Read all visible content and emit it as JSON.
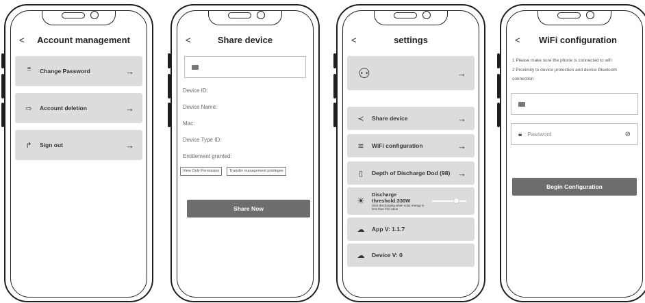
{
  "account": {
    "title": "Account management",
    "back": "<",
    "items": [
      {
        "label": "Change Password",
        "icon": "password-dots-icon"
      },
      {
        "label": "Account deletion",
        "icon": "logout-arrow-icon"
      },
      {
        "label": "Sign out",
        "icon": "sign-out-icon"
      }
    ],
    "arrow": "→"
  },
  "share": {
    "title": "Share device",
    "back": "<",
    "email_placeholder": "",
    "fields": [
      "Device ID:",
      "Device Name:",
      "Mac:",
      "Device Type ID:",
      "Entitlement granted:"
    ],
    "perm_view": "View Only Permission",
    "perm_transfer": "Transfer management privileges",
    "submit": "Share Now"
  },
  "settings": {
    "title": "settings",
    "back": "<",
    "arrow": "→",
    "items": [
      {
        "label": "Share device",
        "icon": "share-icon"
      },
      {
        "label": "WiFi configuration",
        "icon": "wifi-icon"
      },
      {
        "label": "Depth of Discharge Dod (98)",
        "icon": "battery-icon"
      }
    ],
    "discharge": {
      "title": "Discharge threshold:330W",
      "note": "Start discharging when solar energy is less than this value",
      "level": 0.7
    },
    "app_version": "App V: 1.1.7",
    "device_version": "Device V: 0"
  },
  "wifi": {
    "title": "WiFi configuration",
    "back": "<",
    "note1": "1 Please make sure the phone is connected to wifi",
    "note2": "2 Proximity to device protection and device Bluetooth connection",
    "email_placeholder": "",
    "password_placeholder": "Password",
    "submit": "Begin Configuration"
  }
}
